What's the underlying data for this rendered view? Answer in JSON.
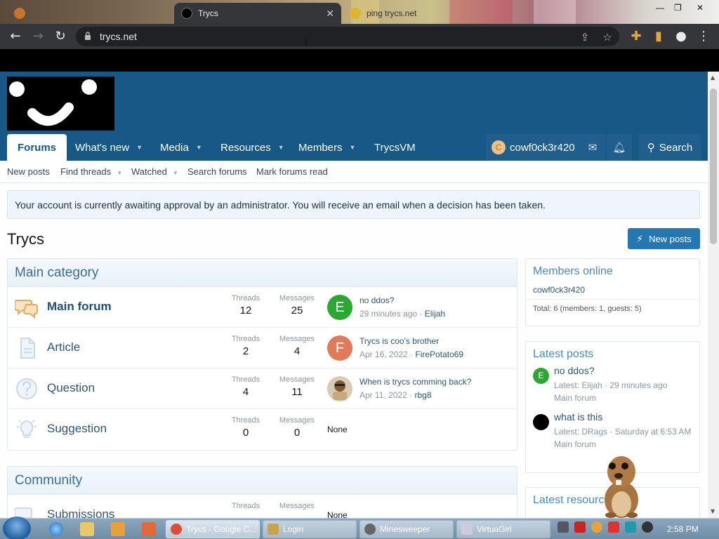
{
  "browser": {
    "tabs": [
      {
        "title": "",
        "active": false
      },
      {
        "title": "Trycs",
        "active": true
      },
      {
        "title": "ping trycs.net",
        "active": false
      }
    ],
    "url": "trycs.net"
  },
  "site": {
    "nav": [
      {
        "label": "Forums",
        "active": true,
        "has_menu": false
      },
      {
        "label": "What's new",
        "active": false,
        "has_menu": true
      },
      {
        "label": "Media",
        "active": false,
        "has_menu": true
      },
      {
        "label": "Resources",
        "active": false,
        "has_menu": true
      },
      {
        "label": "Members",
        "active": false,
        "has_menu": true
      },
      {
        "label": "TrycsVM",
        "active": false,
        "has_menu": false
      }
    ],
    "user": {
      "initial": "C",
      "name": "cowf0ck3r420"
    },
    "search_label": "Search",
    "subnav": [
      {
        "label": "New posts",
        "has_menu": false
      },
      {
        "label": "Find threads",
        "has_menu": true
      },
      {
        "label": "Watched",
        "has_menu": true
      },
      {
        "label": "Search forums",
        "has_menu": false
      },
      {
        "label": "Mark forums read",
        "has_menu": false
      }
    ],
    "notice": "Your account is currently awaiting approval by an administrator. You will receive an email when a decision has been taken.",
    "page_title": "Trycs",
    "new_posts_button": "New posts",
    "categories": [
      {
        "title": "Main category",
        "nodes": [
          {
            "icon": "chat-bubbles-icon",
            "title": "Main forum",
            "unread": true,
            "threads_label": "Threads",
            "threads": "12",
            "messages_label": "Messages",
            "messages": "25",
            "last": {
              "avatar": "E",
              "avatar_color": "#2aa830",
              "title": "no ddos?",
              "time": "29 minutes ago",
              "user": "Elijah"
            }
          },
          {
            "icon": "document-icon",
            "title": "Article",
            "unread": false,
            "threads_label": "Threads",
            "threads": "2",
            "messages_label": "Messages",
            "messages": "4",
            "last": {
              "avatar": "F",
              "avatar_color": "#e07a58",
              "title": "Trycs is coo's brother",
              "time": "Apr 16, 2022",
              "user": "FirePotato69"
            }
          },
          {
            "icon": "question-circle-icon",
            "title": "Question",
            "unread": false,
            "threads_label": "Threads",
            "threads": "4",
            "messages_label": "Messages",
            "messages": "11",
            "last": {
              "avatar": "",
              "avatar_color": "#7a5a3a",
              "title": "When is trycs comming back?",
              "time": "Apr 11, 2022",
              "user": "rbg8"
            }
          },
          {
            "icon": "lightbulb-icon",
            "title": "Suggestion",
            "unread": false,
            "threads_label": "Threads",
            "threads": "0",
            "messages_label": "Messages",
            "messages": "0",
            "last": null,
            "none_label": "None"
          }
        ]
      },
      {
        "title": "Community",
        "nodes": [
          {
            "icon": "chat-bubbles-icon",
            "title": "Submissions",
            "unread": false,
            "threads_label": "Threads",
            "threads": "",
            "messages_label": "Messages",
            "messages": "",
            "last": null,
            "none_label": "None"
          }
        ]
      }
    ],
    "sidebar": {
      "members_online": {
        "title": "Members online",
        "members": [
          "cowf0ck3r420"
        ],
        "total": "Total: 6 (members: 1, guests: 5)"
      },
      "latest_posts": {
        "title": "Latest posts",
        "items": [
          {
            "avatar": "E",
            "avatar_color": "#2aa830",
            "title": "no ddos?",
            "meta": "Latest: Elijah · 29 minutes ago",
            "forum": "Main forum"
          },
          {
            "avatar": "",
            "avatar_color": "#000000",
            "title": "what is this",
            "meta": "Latest: DRags · Saturday at 6:53 AM",
            "forum": "Main forum"
          }
        ]
      },
      "latest_resources": {
        "title": "Latest resources"
      }
    }
  },
  "taskbar": {
    "windows": [
      {
        "label": "Trycs - Google C...",
        "icon_color": "#e04b3a"
      },
      {
        "label": "Login",
        "icon_color": "#c9a24a"
      },
      {
        "label": "Minesweeper",
        "icon_color": "#666"
      },
      {
        "label": "VirtuaGirl",
        "icon_color": "#ccd"
      }
    ],
    "clock": "2:58 PM"
  }
}
